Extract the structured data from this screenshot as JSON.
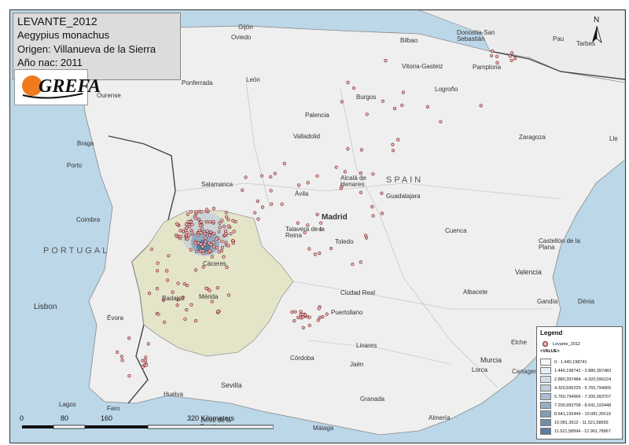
{
  "title_lines": [
    "LEVANTE_2012",
    "Aegypius monachus",
    "Origen: Villanueva de la Sierra",
    "Año nac: 2011"
  ],
  "logo": "GREFA",
  "north_label": "N",
  "countries": {
    "spain": "SPAIN",
    "portugal": "PORTUGAL"
  },
  "places": {
    "gijon": "Gijón",
    "oviedo": "Oviedo",
    "bilbao": "Bilbao",
    "donostia": "Donostia-San Sebastián",
    "pau": "Pau",
    "tarbes": "Tarbes",
    "ponferrada": "Ponferrada",
    "leon": "León",
    "vitoria": "Vitoria-Gasteiz",
    "pamplona": "Pamplona",
    "ourense": "Ourense",
    "burgos": "Burgos",
    "logrono": "Logroño",
    "palencia": "Palencia",
    "braga": "Braga",
    "valladolid": "Valladolid",
    "zaragoza": "Zaragoza",
    "lleida": "Lle",
    "porto": "Porto",
    "salamanca": "Salamanca",
    "avila": "Ávila",
    "alcala": "Alcalá de Henares",
    "guadalajara": "Guadalajara",
    "madrid": "Madrid",
    "coimbra": "Coimbra",
    "talavera": "Talavera de la Reina",
    "toledo": "Toledo",
    "cuenca": "Cuenca",
    "castellon": "Castellón de la Plana",
    "caceres": "Cáceres",
    "valencia": "Valencia",
    "badajoz": "Badajoz",
    "merida": "Mérida",
    "ciudadreal": "Ciudad Real",
    "albacete": "Albacete",
    "gandia": "Gandía",
    "denia": "Dénia",
    "lisbon": "Lisbon",
    "evora": "Évora",
    "puertollano": "Puertollano",
    "elche": "Elche",
    "linares": "Linares",
    "cordoba": "Córdoba",
    "jaen": "Jaén",
    "murcia": "Murcia",
    "lorca": "Lorca",
    "cartagena": "Cartagena",
    "sevilla": "Sevilla",
    "granada": "Granada",
    "huelva": "Huelva",
    "lagos": "Lagos",
    "faro": "Faro",
    "almeria": "Almería",
    "jerez": "Jerez de la Frontera",
    "malaga": "Málaga"
  },
  "scale": {
    "ticks": [
      "0",
      "80",
      "160",
      "320 Kilometers"
    ]
  },
  "legend": {
    "title": "Legend",
    "points_label": "Levante_2012",
    "value_header": "<VALUE>",
    "classes": [
      {
        "label": "0 - 1.440,198741",
        "color": "#f4f7fa"
      },
      {
        "label": "1.440,198742 - 2.880,397483",
        "color": "#e4ecf2"
      },
      {
        "label": "2.880,397484 - 4.320,596224",
        "color": "#d2dde7"
      },
      {
        "label": "4.320,596225 - 5.760,794965",
        "color": "#bfcedc"
      },
      {
        "label": "5.760,794966 - 7.200,993707",
        "color": "#abbfd0"
      },
      {
        "label": "7.200,993708 - 8.641,192448",
        "color": "#97afc4"
      },
      {
        "label": "8.641,192449 - 10.081,39119",
        "color": "#829fb8"
      },
      {
        "label": "10.081,3912 - 11.521,58993",
        "color": "#6e8fac"
      },
      {
        "label": "11.521,58994 - 12.961,78867",
        "color": "#5a7fa0"
      }
    ]
  },
  "colors": {
    "sea": "#bcd7e8",
    "land": "#efefef",
    "study_area": "#e4e4c8",
    "point_fill": "#f0b5b5",
    "point_stroke": "#6a1a1a"
  }
}
